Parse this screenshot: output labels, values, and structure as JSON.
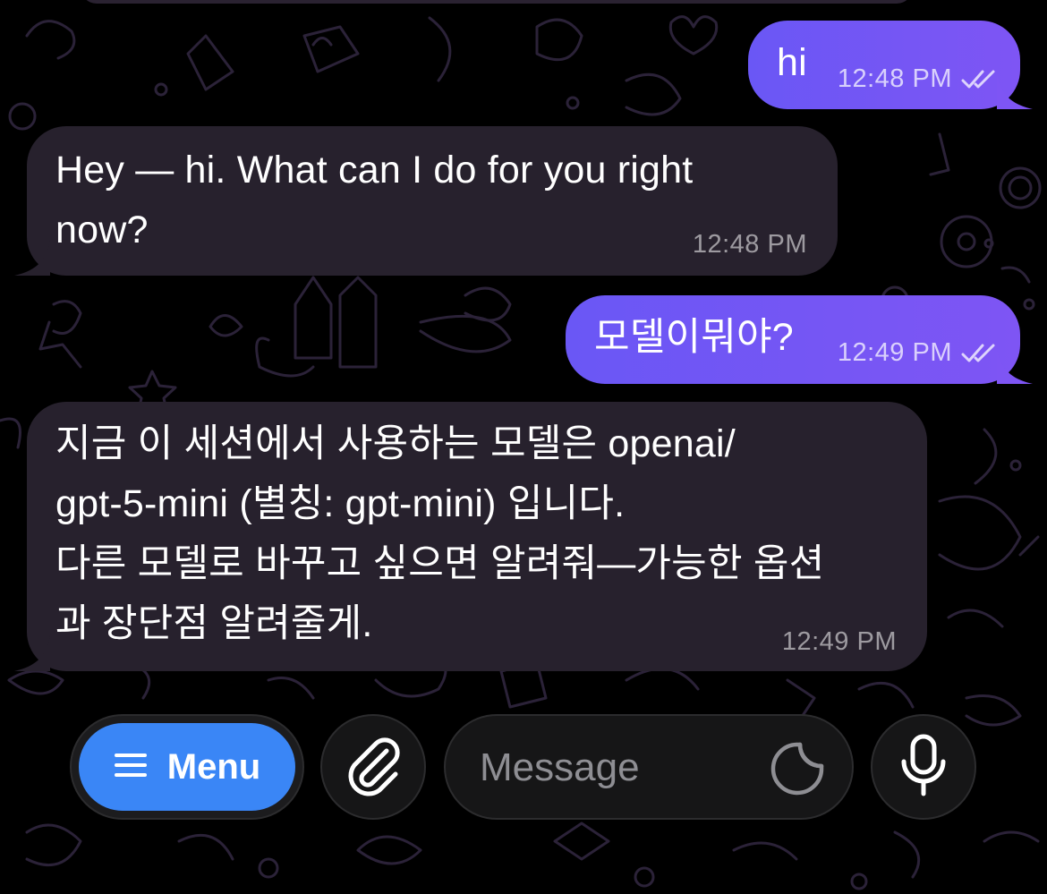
{
  "messages": [
    {
      "direction": "outgoing",
      "text": "hi",
      "time": "12:48 PM",
      "status": "read"
    },
    {
      "direction": "incoming",
      "lines": [
        "Hey — hi. What can I do for you right",
        "now?"
      ],
      "time": "12:48 PM"
    },
    {
      "direction": "outgoing",
      "text": "모델이뭐야?",
      "time": "12:49 PM",
      "status": "read"
    },
    {
      "direction": "incoming",
      "lines": [
        "지금 이 세션에서 사용하는 모델은 openai/",
        "gpt-5-mini (별칭: gpt-mini) 입니다.",
        "다른 모델로 바꾸고 싶으면 알려줘—가능한 옵션",
        "과 장단점 알려줄게."
      ],
      "time": "12:49 PM"
    }
  ],
  "composer": {
    "menu_label": "Menu",
    "menu_icon": "hamburger-icon",
    "attach_icon": "paperclip-icon",
    "input_value": "",
    "input_placeholder": "Message",
    "sticker_icon": "sticker-icon",
    "mic_icon": "microphone-icon"
  },
  "colors": {
    "outgoing_bubble": "#6a57f5",
    "incoming_bubble": "#27212d",
    "menu_button": "#3a86f6",
    "background": "#000000"
  }
}
